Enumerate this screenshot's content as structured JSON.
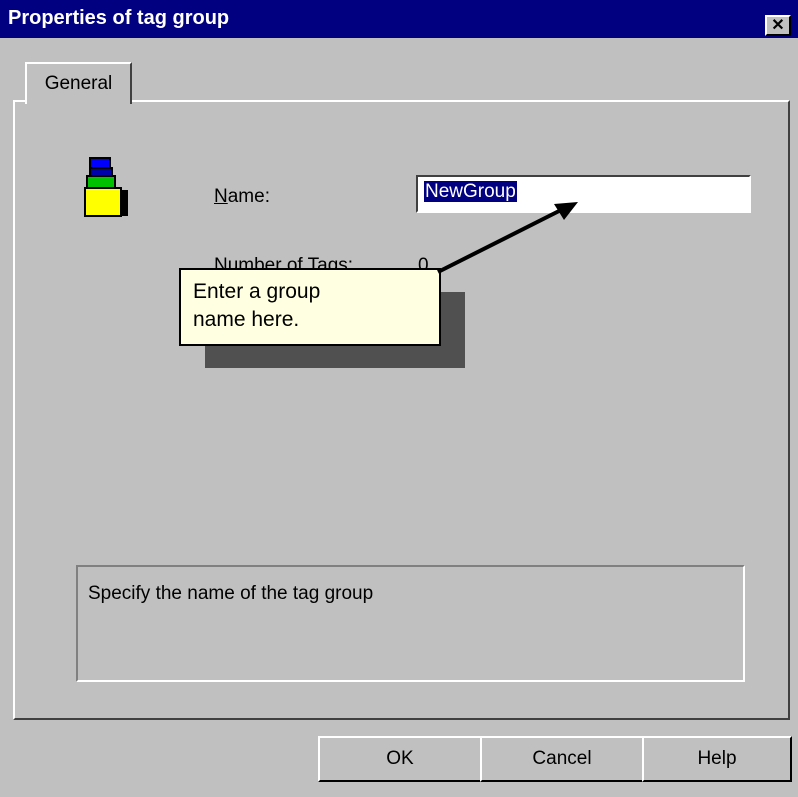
{
  "window": {
    "title": "Properties of tag group",
    "close_label": "✕"
  },
  "tabs": [
    {
      "label": "General",
      "active": true
    }
  ],
  "form": {
    "name_label_accel": "N",
    "name_label_rest": "ame:",
    "name_value": "NewGroup",
    "num_tags_label": "Number of Tags:",
    "num_tags_value": "0"
  },
  "icon": {
    "name": "tag-group-stack-icon",
    "colors": [
      "#0000ff",
      "#00c000",
      "#ffff00"
    ]
  },
  "callout": {
    "line1": "Enter a group",
    "line2": "name here."
  },
  "description": {
    "text": "Specify the name of the tag group"
  },
  "buttons": {
    "ok": "OK",
    "cancel": "Cancel",
    "help": "Help"
  }
}
